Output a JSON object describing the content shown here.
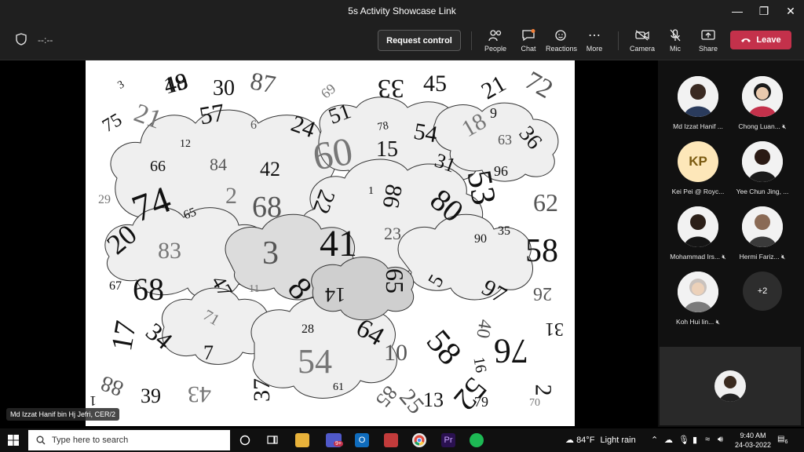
{
  "window": {
    "title": "5s Activity Showcase Link"
  },
  "toolbar": {
    "timer": "--:--",
    "request_control": "Request control",
    "people": "People",
    "chat": "Chat",
    "reactions": "Reactions",
    "more": "More",
    "camera": "Camera",
    "mic": "Mic",
    "share": "Share",
    "leave": "Leave"
  },
  "stage": {
    "presenter_label": "Md Izzat Hanif bin Hj Jefri, CER/2"
  },
  "participants": [
    {
      "name": "Md Izzat Hanif ...",
      "muted": false
    },
    {
      "name": "Chong Luan...",
      "muted": true
    },
    {
      "name": "Kei Pei @ Royc...",
      "initials": "KP",
      "muted": false
    },
    {
      "name": "Yee Chun Jing, ...",
      "muted": false
    },
    {
      "name": "Mohammad Irs...",
      "muted": true
    },
    {
      "name": "Hermi Fariz...",
      "muted": true
    },
    {
      "name": "Koh Hui lin...",
      "muted": true
    }
  ],
  "more_participants": "+2",
  "taskbar": {
    "search_placeholder": "Type here to search",
    "teams_badge": "9+",
    "weather_temp": "84°F",
    "weather_text": "Light rain",
    "time": "9:40 AM",
    "date": "24-03-2022",
    "notifications": "6"
  },
  "numbers": [
    "48",
    "30",
    "87",
    "69",
    "33",
    "45",
    "21",
    "72",
    "3",
    "75",
    "21",
    "57",
    "6",
    "24",
    "51",
    "78",
    "54",
    "18",
    "9",
    "36",
    "12",
    "66",
    "84",
    "42",
    "09",
    "15",
    "31",
    "63",
    "96",
    "1",
    "74",
    "2",
    "68",
    "22",
    "86",
    "80",
    "53",
    "62",
    "29",
    "65",
    "20",
    "41",
    "23",
    "35",
    "90",
    "83",
    "58",
    "3",
    "8",
    "67",
    "68",
    "47",
    "11",
    "14",
    "65",
    "5",
    "97",
    "26",
    "17",
    "71",
    "28",
    "64",
    "40",
    "31",
    "34",
    "7",
    "54",
    "10",
    "58",
    "76",
    "16",
    "52",
    "88",
    "43",
    "39",
    "37",
    "61",
    "85",
    "13",
    "79",
    "70",
    "2",
    "25",
    "1",
    "19"
  ]
}
